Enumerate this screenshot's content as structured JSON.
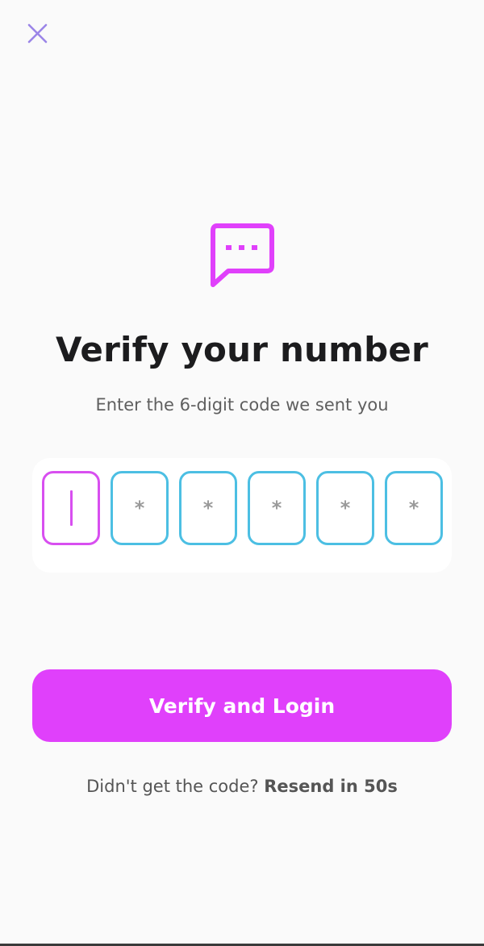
{
  "header": {
    "close_icon": "close-icon"
  },
  "hero": {
    "icon": "chat-bubble-ellipsis-icon",
    "title": "Verify your number",
    "subtitle": "Enter the 6-digit code we sent you"
  },
  "code_input": {
    "length": 6,
    "placeholder": "*",
    "boxes": [
      "",
      "*",
      "*",
      "*",
      "*",
      "*"
    ],
    "active_index": 0
  },
  "actions": {
    "verify_label": "Verify and Login"
  },
  "resend": {
    "prompt": "Didn't get the code?",
    "link_label": "Resend in 50s"
  },
  "colors": {
    "accent": "#e040fb",
    "active_border": "#d84ff0",
    "box_border": "#4cbfe3",
    "close_icon": "#9b85e8",
    "background": "#fafafa",
    "title": "#1c1c1e"
  }
}
